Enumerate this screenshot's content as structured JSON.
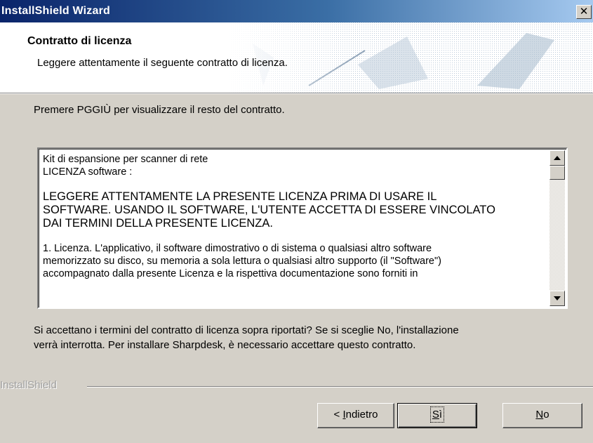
{
  "window": {
    "title": "InstallShield Wizard",
    "close_glyph": "✕"
  },
  "header": {
    "title": "Contratto di licenza",
    "subtitle": "Leggere attentamente il seguente contratto di licenza."
  },
  "instruction": "Premere PGGIÙ per visualizzare il resto del contratto.",
  "license": {
    "line1": "Kit di espansione per scanner di rete",
    "line2": "LICENZA software :",
    "warning_lines": [
      "LEGGERE ATTENTAMENTE LA PRESENTE LICENZA PRIMA DI USARE IL",
      "SOFTWARE. USANDO IL SOFTWARE, L'UTENTE ACCETTA DI ESSERE VINCOLATO",
      "DAI TERMINI DELLA PRESENTE LICENZA."
    ],
    "clause_lines": [
      "1. Licenza.  L'applicativo, il software dimostrativo o di sistema o qualsiasi altro software",
      "memorizzato su disco, su memoria a sola lettura o qualsiasi altro supporto (il \"Software\")",
      "accompagnato dalla presente Licenza e la rispettiva documentazione sono forniti in"
    ]
  },
  "question": {
    "line1": "Si accettano i termini del contratto di licenza sopra riportati?  Se si sceglie No, l'installazione",
    "line2": "verrà interrotta.  Per installare Sharpdesk, è necessario accettare questo contratto."
  },
  "branding": "InstallShield",
  "buttons": {
    "back_prefix": "< ",
    "back_accel": "I",
    "back_rest": "ndietro",
    "yes_accel": "S",
    "yes_rest": "ì",
    "no_accel": "N",
    "no_rest": "o"
  }
}
